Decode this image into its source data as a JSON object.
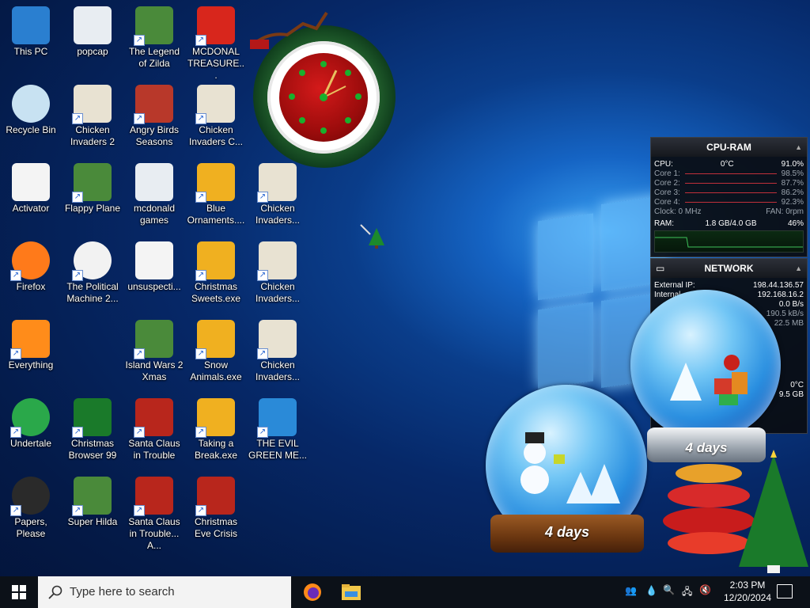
{
  "desktop": {
    "icons": [
      {
        "label": "This PC",
        "icon": "computer-icon"
      },
      {
        "label": "popcap",
        "icon": "folder-icon"
      },
      {
        "label": "The Legend of Zilda",
        "icon": "game-icon"
      },
      {
        "label": "MCDONAL TREASURE...",
        "icon": "mcdonalds-icon"
      },
      {
        "label": "Recycle Bin",
        "icon": "recycle-bin-icon"
      },
      {
        "label": "Chicken Invaders 2",
        "icon": "chicken-icon"
      },
      {
        "label": "Angry Birds Seasons",
        "icon": "angry-birds-icon"
      },
      {
        "label": "Chicken Invaders C...",
        "icon": "chicken-icon"
      },
      {
        "label": "Activator",
        "icon": "document-icon"
      },
      {
        "label": "Flappy Plane",
        "icon": "game-icon"
      },
      {
        "label": "mcdonald games",
        "icon": "folder-icon"
      },
      {
        "label": "Blue Ornaments....",
        "icon": "installer-icon"
      },
      {
        "label": "Chicken Invaders...",
        "icon": "chicken-icon"
      },
      {
        "label": "Firefox",
        "icon": "firefox-icon"
      },
      {
        "label": "The Political Machine 2...",
        "icon": "political-icon"
      },
      {
        "label": "unsuspecti...",
        "icon": "document-icon"
      },
      {
        "label": "Christmas Sweets.exe",
        "icon": "installer-icon"
      },
      {
        "label": "Chicken Invaders...",
        "icon": "chicken-icon"
      },
      {
        "label": "Everything",
        "icon": "search-magnifier-icon"
      },
      {
        "label": "Island Wars 2 Xmas",
        "icon": "game-icon"
      },
      {
        "label": "Snow Animals.exe",
        "icon": "installer-icon"
      },
      {
        "label": "Chicken Invaders...",
        "icon": "chicken-icon"
      },
      {
        "label": "Undertale",
        "icon": "undertale-icon"
      },
      {
        "label": "Christmas Browser 99",
        "icon": "christmas-tree-icon"
      },
      {
        "label": "Santa Claus in Trouble",
        "icon": "santa-icon"
      },
      {
        "label": "Taking a Break.exe",
        "icon": "installer-icon"
      },
      {
        "label": "THE EVIL GREEN ME...",
        "icon": "messenger-icon"
      },
      {
        "label": "Papers, Please",
        "icon": "papers-please-icon"
      },
      {
        "label": "Super Hilda",
        "icon": "game-icon"
      },
      {
        "label": "Santa Claus in Trouble... A...",
        "icon": "santa-icon"
      },
      {
        "label": "Christmas Eve Crisis",
        "icon": "santa-icon"
      }
    ]
  },
  "cpu_ram": {
    "title": "CPU-RAM",
    "cpu_label": "CPU:",
    "cpu_temp": "0°C",
    "cpu_value": "91.0%",
    "cores": [
      {
        "label": "Core 1:",
        "value": "98.5%"
      },
      {
        "label": "Core 2:",
        "value": "87.7%"
      },
      {
        "label": "Core 3:",
        "value": "86.2%"
      },
      {
        "label": "Core 4:",
        "value": "92.3%"
      }
    ],
    "clock": "Clock: 0 MHz",
    "fan": "FAN: 0rpm",
    "ram_label": "RAM:",
    "ram_value": "1.8 GB/4.0 GB",
    "ram_percent": "46%"
  },
  "network": {
    "title": "NETWORK",
    "external_ip_label": "External IP:",
    "external_ip": "198.44.136.57",
    "internal_label": "Internal",
    "internal_ip": "192.168.16.2",
    "rate": "0.0 B/s",
    "rate2": "190.5 kB/s",
    "total": "22.5 MB"
  },
  "third_gadget": {
    "temp": "0°C",
    "size": "9.5 GB"
  },
  "globes": {
    "left_days": "4 days",
    "right_days": "4 days"
  },
  "taskbar": {
    "search_placeholder": "Type here to search",
    "time": "2:03 PM",
    "date": "12/20/2024"
  }
}
